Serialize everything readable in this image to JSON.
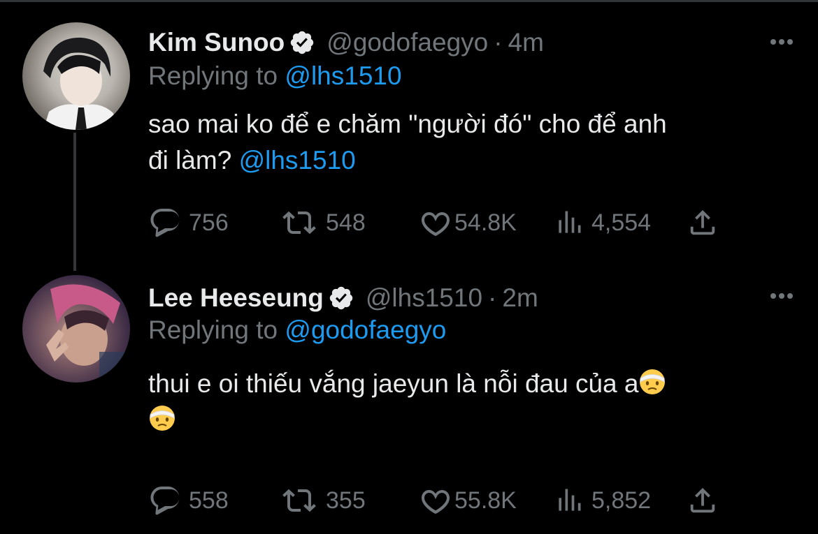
{
  "tweets": [
    {
      "name": "Kim Sunoo",
      "handle": "@godofaegyo",
      "separator": "·",
      "time": "4m",
      "replying_prefix": "Replying to ",
      "replying_to": "@lhs1510",
      "text_line1": "sao mai ko để e chăm \"người đó\" cho để anh",
      "text_line2_prefix": "đi làm? ",
      "text_line2_mention": "@lhs1510",
      "stats": {
        "replies": "756",
        "retweets": "548",
        "likes": "54.8K",
        "views": "4,554"
      }
    },
    {
      "name": "Lee Heeseung",
      "handle": "@lhs1510",
      "separator": "·",
      "time": "2m",
      "replying_prefix": "Replying to ",
      "replying_to": "@godofaegyo",
      "text_line1": "thui e oi thiếu vắng jaeyun là nỗi đau của a",
      "emoji": "face-with-head-bandage",
      "stats": {
        "replies": "558",
        "retweets": "355",
        "likes": "55.8K",
        "views": "5,852"
      }
    }
  ],
  "colors": {
    "background": "#000000",
    "text": "#e7e9ea",
    "muted": "#71767b",
    "accent": "#1d9bf0"
  }
}
